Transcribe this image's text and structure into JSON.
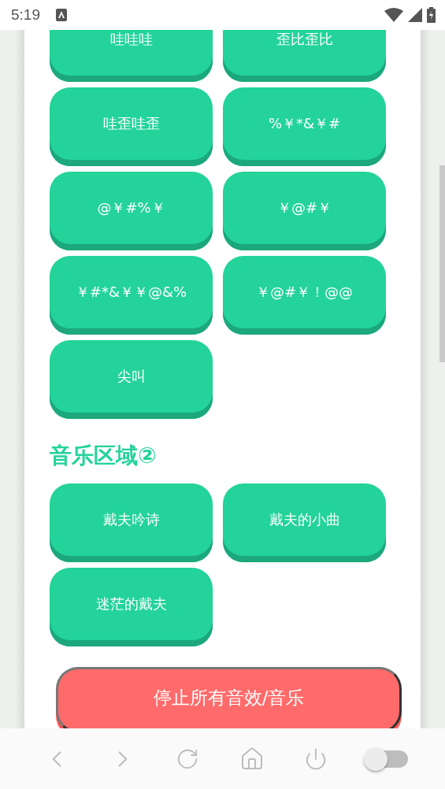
{
  "status_bar": {
    "time": "5:19"
  },
  "sections": [
    {
      "buttons": [
        "哇哇哇",
        "歪比歪比",
        "哇歪哇歪",
        "%￥*&￥#",
        "@￥#%￥",
        "￥@#￥",
        "￥#*&￥￥@&%",
        "￥@#￥！@@",
        "尖叫"
      ]
    },
    {
      "title": "音乐区域②",
      "buttons": [
        "戴夫吟诗",
        "戴夫的小曲",
        "迷茫的戴夫"
      ]
    }
  ],
  "stop_button": {
    "label": "停止所有音效/音乐"
  },
  "nav_bar": {
    "toggle": {
      "on": false
    }
  }
}
